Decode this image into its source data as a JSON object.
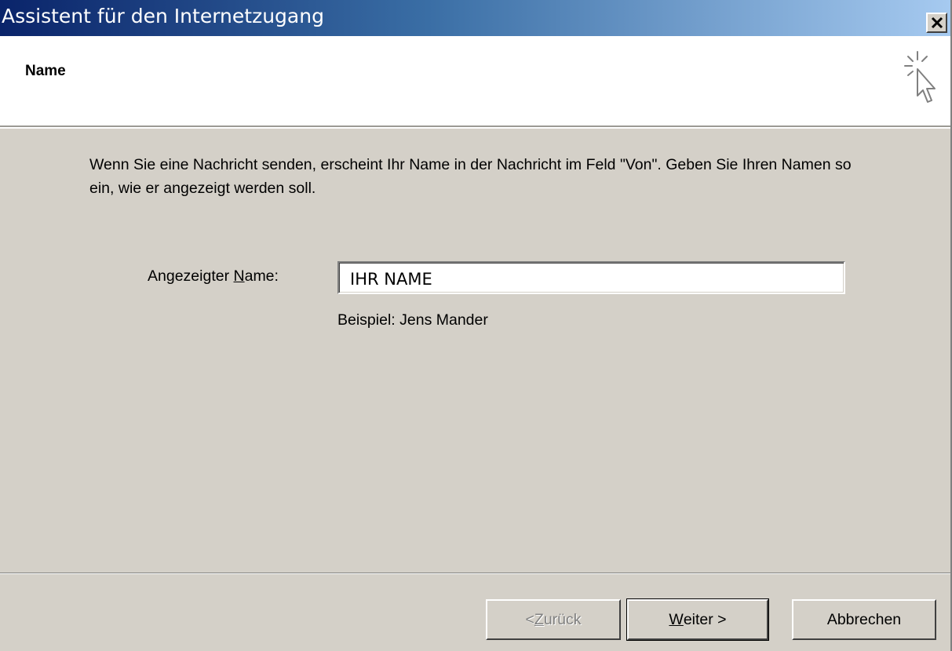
{
  "window": {
    "title": "Assistent für den Internetzugang",
    "close_symbol": "close-icon"
  },
  "header": {
    "title": "Name",
    "icon": "wizard-cursor-icon"
  },
  "content": {
    "intro_text": "Wenn Sie eine Nachricht senden, erscheint Ihr Name in der Nachricht im Feld \"Von\". Geben Sie Ihren Namen so ein, wie er angezeigt werden soll.",
    "field_label_prefix": "Angezeigter ",
    "field_label_accel": "N",
    "field_label_suffix": "ame:",
    "name_value": "IHR NAME",
    "example_text": "Beispiel: Jens Mander"
  },
  "buttons": {
    "back_prefix": "< ",
    "back_accel": "Z",
    "back_suffix": "urück",
    "next_accel": "W",
    "next_suffix": "eiter >",
    "cancel_label": "Abbrechen"
  },
  "colors": {
    "dialog_bg": "#d4d0c8",
    "title_gradient_start": "#0a246a",
    "title_gradient_end": "#a6caf0"
  }
}
